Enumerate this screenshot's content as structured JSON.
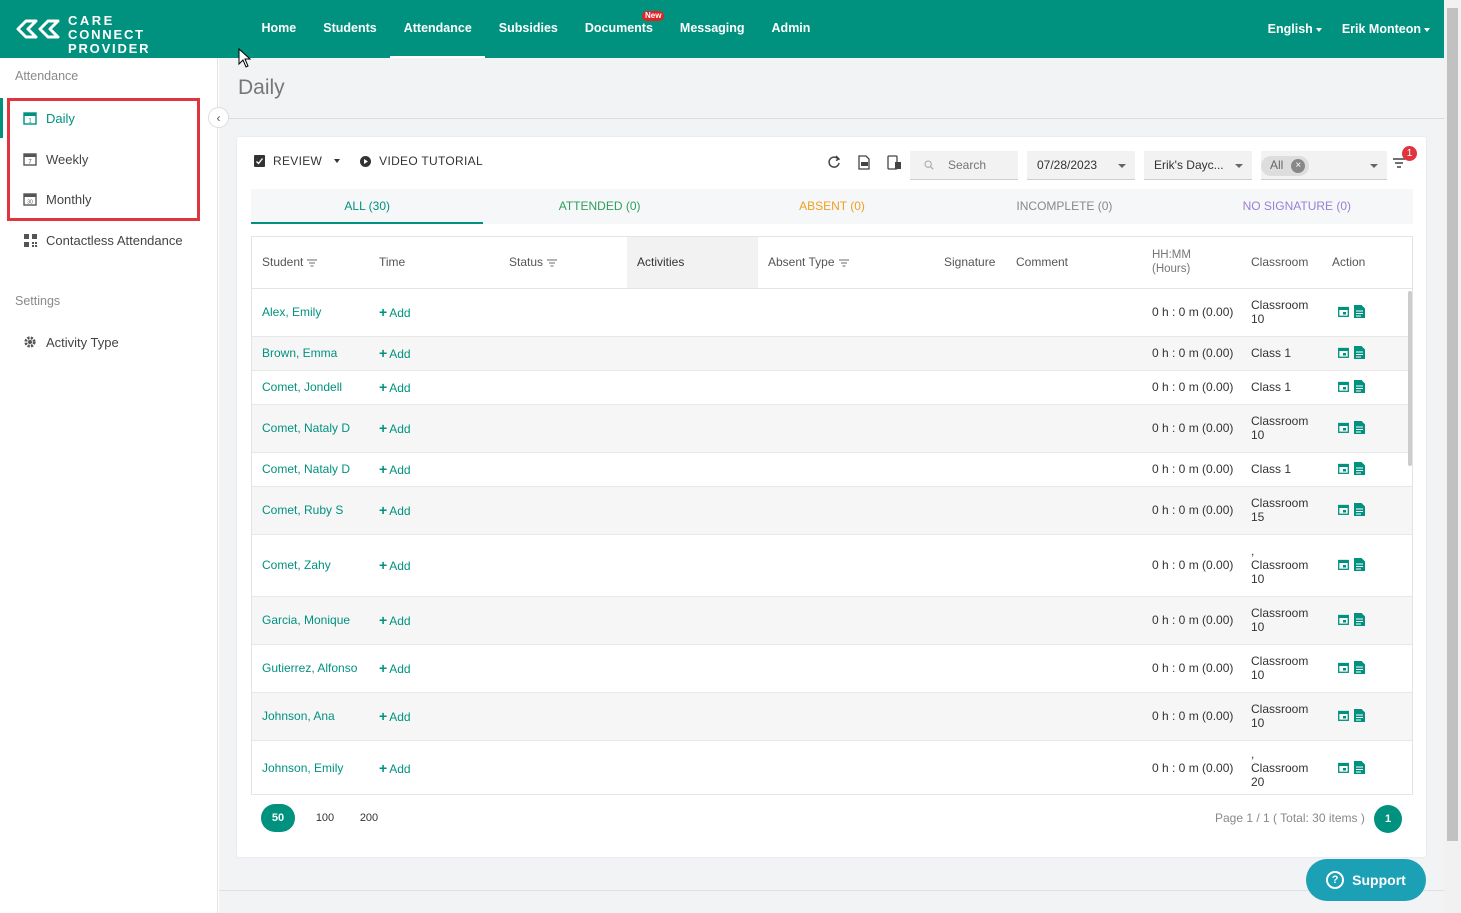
{
  "brand": {
    "line1": "CARE",
    "line2": "CONNECT PROVIDER"
  },
  "nav": {
    "items": [
      {
        "label": "Home"
      },
      {
        "label": "Students"
      },
      {
        "label": "Attendance"
      },
      {
        "label": "Subsidies"
      },
      {
        "label": "Documents",
        "badge": "New"
      },
      {
        "label": "Messaging"
      },
      {
        "label": "Admin"
      }
    ],
    "language": "English",
    "user": "Erik Monteon"
  },
  "sidebar": {
    "section_attendance": "Attendance",
    "items": [
      {
        "label": "Daily",
        "icon": "calendar-day-icon"
      },
      {
        "label": "Weekly",
        "icon": "calendar-week-icon"
      },
      {
        "label": "Monthly",
        "icon": "calendar-month-icon"
      },
      {
        "label": "Contactless Attendance",
        "icon": "qr-code-icon"
      }
    ],
    "section_settings": "Settings",
    "settings_items": [
      {
        "label": "Activity Type",
        "icon": "gear-icon"
      }
    ]
  },
  "page": {
    "title": "Daily"
  },
  "toolbar": {
    "review": "REVIEW",
    "video": "VIDEO TUTORIAL",
    "search_placeholder": "Search",
    "date": "07/28/2023",
    "center": "Erik's Dayc...",
    "classroom_chip": "All",
    "filter_count": "1"
  },
  "tabs": [
    {
      "label": "ALL (30)",
      "color": "#00927f"
    },
    {
      "label": "ATTENDED (0)",
      "color": "#2e9e5b"
    },
    {
      "label": "ABSENT (0)",
      "color": "#f0a020"
    },
    {
      "label": "INCOMPLETE (0)",
      "color": "#888888"
    },
    {
      "label": "NO SIGNATURE (0)",
      "color": "#9b7fd4"
    }
  ],
  "table": {
    "headers": {
      "student": "Student",
      "time": "Time",
      "status": "Status",
      "activities": "Activities",
      "absent_type": "Absent Type",
      "signature": "Signature",
      "comment": "Comment",
      "hours_line1": "HH:MM",
      "hours_line2": "(Hours)",
      "classroom": "Classroom",
      "action": "Action"
    },
    "add_label": "Add",
    "rows": [
      {
        "student": "Alex, Emily",
        "hours": "0 h : 0 m (0.00)",
        "classroom": [
          "Classroom",
          "10"
        ]
      },
      {
        "student": "Brown, Emma",
        "hours": "0 h : 0 m (0.00)",
        "classroom": [
          "Class 1"
        ]
      },
      {
        "student": "Comet, Jondell",
        "hours": "0 h : 0 m (0.00)",
        "classroom": [
          "Class 1"
        ]
      },
      {
        "student": "Comet, Nataly D",
        "hours": "0 h : 0 m (0.00)",
        "classroom": [
          "Classroom",
          "10"
        ]
      },
      {
        "student": "Comet, Nataly D",
        "hours": "0 h : 0 m (0.00)",
        "classroom": [
          "Class 1"
        ]
      },
      {
        "student": "Comet, Ruby S",
        "hours": "0 h : 0 m (0.00)",
        "classroom": [
          "Classroom",
          "15"
        ]
      },
      {
        "student": "Comet, Zahy",
        "hours": "0 h : 0 m (0.00)",
        "classroom": [
          ",",
          "Classroom",
          "10"
        ]
      },
      {
        "student": "Garcia, Monique",
        "hours": "0 h : 0 m (0.00)",
        "classroom": [
          "Classroom",
          "10"
        ]
      },
      {
        "student": "Gutierrez, Alfonso",
        "hours": "0 h : 0 m (0.00)",
        "classroom": [
          "Classroom",
          "10"
        ]
      },
      {
        "student": "Johnson, Ana",
        "hours": "0 h : 0 m (0.00)",
        "classroom": [
          "Classroom",
          "10"
        ]
      },
      {
        "student": "Johnson, Emily",
        "hours": "0 h : 0 m (0.00)",
        "classroom": [
          ",",
          "Classroom",
          "20"
        ]
      }
    ]
  },
  "pager": {
    "sizes": [
      "50",
      "100",
      "200"
    ],
    "info": "Page 1 / 1 ( Total: 30 items )",
    "current": "1"
  },
  "support": {
    "label": "Support"
  }
}
